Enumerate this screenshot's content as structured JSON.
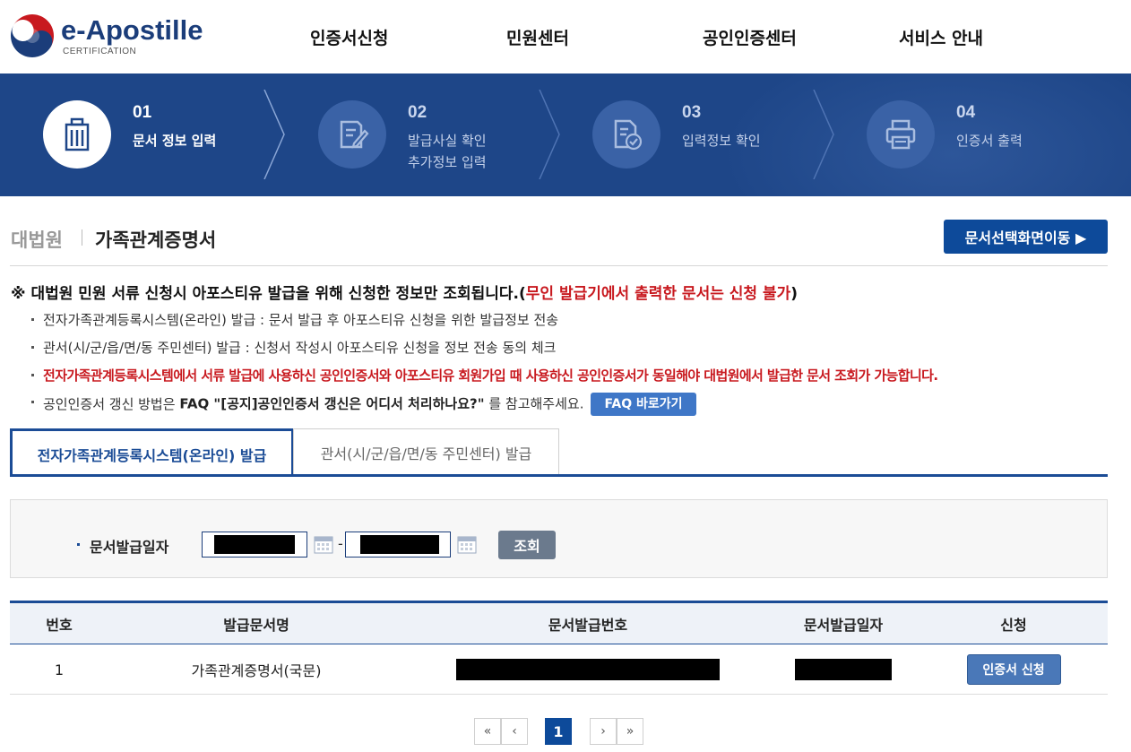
{
  "header": {
    "logo_text": "e-Apostille",
    "logo_sub": "CERTIFICATION",
    "nav": [
      "인증서신청",
      "민원센터",
      "공인인증센터",
      "서비스 안내"
    ]
  },
  "steps": [
    {
      "num": "01",
      "label1": "문서 정보 입력",
      "label2": "",
      "icon": "building-icon"
    },
    {
      "num": "02",
      "label1": "발급사실 확인",
      "label2": "추가정보 입력",
      "icon": "edit-document-icon"
    },
    {
      "num": "03",
      "label1": "입력정보 확인",
      "label2": "",
      "icon": "document-check-icon"
    },
    {
      "num": "04",
      "label1": "인증서 출력",
      "label2": "",
      "icon": "printer-icon"
    }
  ],
  "page": {
    "crumb": "대법원",
    "title": "가족관계증명서",
    "move_button": "문서선택화면이동 ▶"
  },
  "notice": {
    "main": "※ 대법원 민원 서류 신청시 아포스티유 발급을 위해 신청한 정보만 조회됩니다.(",
    "main_red": "무인 발급기에서 출력한 문서는 신청 불가",
    "main_end": ")",
    "bullet1": "전자가족관계등록시스템(온라인) 발급 : 문서 발급 후 아포스티유 신청을 위한 발급정보 전송",
    "bullet2": "관서(시/군/읍/면/동 주민센터) 발급 : 신청서 작성시 아포스티유 신청을 정보 전송 동의 체크",
    "bullet3": "전자가족관계등록시스템에서 서류 발급에 사용하신 공인인증서와 아포스티유 회원가입 때 사용하신 공인인증서가 동일해야 대법원에서 발급한 문서 조회가 가능합니다.",
    "bullet4_pre": "공인인증서 갱신 방법은",
    "bullet4_bold": "FAQ \"[공지]공인인증서 갱신은 어디서 처리하나요?\"",
    "bullet4_post": "를 참고해주세요.",
    "faq_button": "FAQ 바로가기"
  },
  "tabs": [
    "전자가족관계등록시스템(온라인) 발급",
    "관서(시/군/읍/면/동 주민센터) 발급"
  ],
  "search": {
    "label": "문서발급일자",
    "separator": "-",
    "button": "조회"
  },
  "table": {
    "headers": [
      "번호",
      "발급문서명",
      "문서발급번호",
      "문서발급일자",
      "신청"
    ],
    "rows": [
      {
        "no": "1",
        "name": "가족관계증명서(국문)",
        "action": "인증서 신청"
      }
    ]
  },
  "pagination": {
    "first": "«",
    "prev": "‹",
    "current": "1",
    "next": "›",
    "last": "»"
  },
  "colors": {
    "brand": "#1e4688",
    "accent_button": "#0d4a9a",
    "warning_red": "#c8191f"
  }
}
